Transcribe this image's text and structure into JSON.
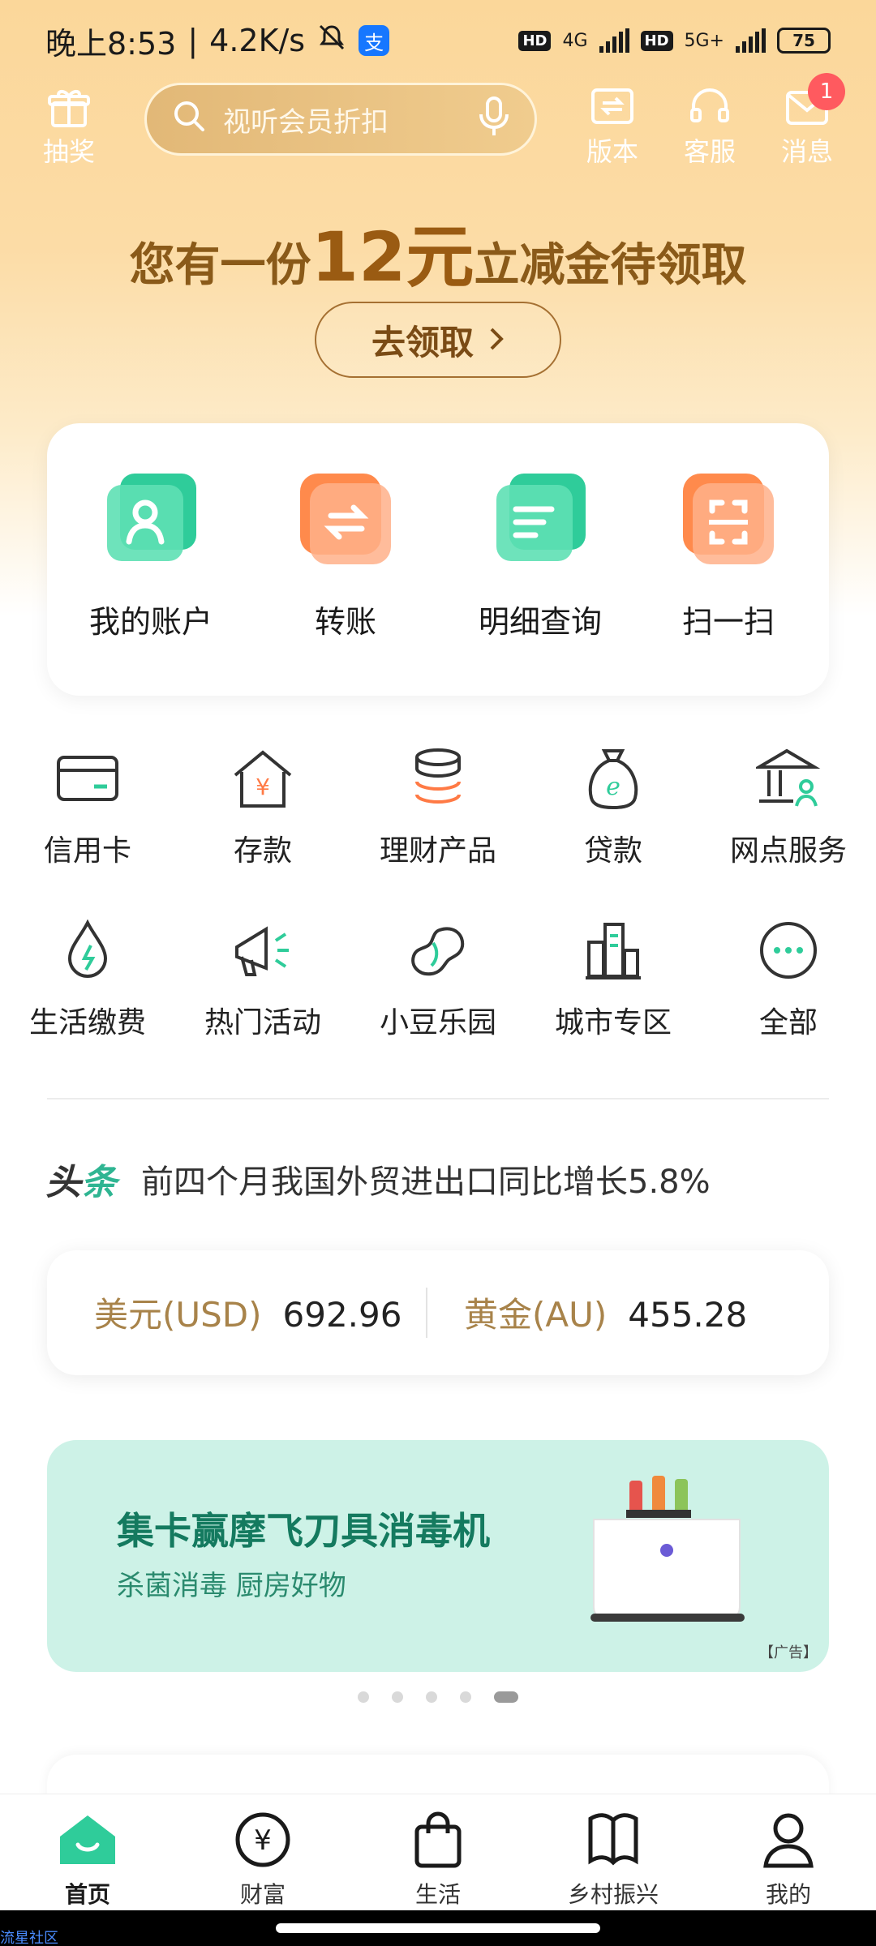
{
  "status_bar": {
    "time": "晚上8:53",
    "speed": "4.2K/s",
    "hd1": "HD",
    "net1": "4G",
    "hd2": "HD",
    "net2": "5G+",
    "battery": "75"
  },
  "top_bar": {
    "lottery_label": "抽奖",
    "search_placeholder": "视听会员折扣",
    "version_label": "版本",
    "service_label": "客服",
    "message_label": "消息",
    "message_badge": "1"
  },
  "promo": {
    "title_before": "您有一份",
    "title_amount": "12元",
    "title_after": "立减金待领取",
    "button_label": "去领取"
  },
  "quick_actions": [
    {
      "label": "我的账户",
      "icon": "account-icon"
    },
    {
      "label": "转账",
      "icon": "transfer-icon"
    },
    {
      "label": "明细查询",
      "icon": "statement-icon"
    },
    {
      "label": "扫一扫",
      "icon": "scan-icon"
    }
  ],
  "grid": [
    {
      "label": "信用卡",
      "icon": "credit-card-icon"
    },
    {
      "label": "存款",
      "icon": "deposit-icon"
    },
    {
      "label": "理财产品",
      "icon": "wealth-products-icon"
    },
    {
      "label": "贷款",
      "icon": "loan-icon"
    },
    {
      "label": "网点服务",
      "icon": "branch-service-icon"
    },
    {
      "label": "生活缴费",
      "icon": "utility-payment-icon"
    },
    {
      "label": "热门活动",
      "icon": "campaign-icon"
    },
    {
      "label": "小豆乐园",
      "icon": "bean-park-icon"
    },
    {
      "label": "城市专区",
      "icon": "city-zone-icon"
    },
    {
      "label": "全部",
      "icon": "more-icon"
    }
  ],
  "headline": {
    "tag_a": "头",
    "tag_b": "条",
    "text": "前四个月我国外贸进出口同比增长5.8%"
  },
  "rates": [
    {
      "name": "美元(USD)",
      "value": "692.96"
    },
    {
      "name": "黄金(AU)",
      "value": "455.28"
    }
  ],
  "ad": {
    "title": "集卡赢摩飞刀具消毒机",
    "subtitle": "杀菌消毒 厨房好物",
    "tag": "【广告】",
    "carousel_count": 5,
    "carousel_active": 5
  },
  "bottom_nav": [
    {
      "label": "首页",
      "icon": "home-icon",
      "active": true
    },
    {
      "label": "财富",
      "icon": "wealth-icon"
    },
    {
      "label": "生活",
      "icon": "life-bag-icon"
    },
    {
      "label": "乡村振兴",
      "icon": "rural-book-icon"
    },
    {
      "label": "我的",
      "icon": "profile-icon"
    }
  ],
  "watermark": "流星社区",
  "colors": {
    "brand_green": "#2fcc9a",
    "gold_text": "#8a5a19",
    "accent_orange": "#ff8a4c"
  }
}
